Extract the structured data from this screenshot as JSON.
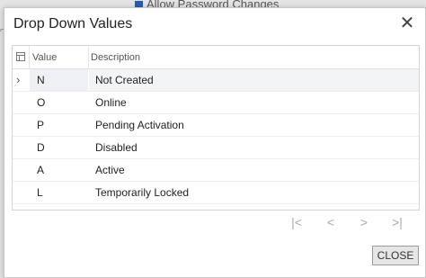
{
  "background": {
    "partial_label": "Allow Password Changes"
  },
  "dialog": {
    "title": "Drop Down Values",
    "close_icon": "close-icon",
    "close_button_label": "CLOSE"
  },
  "grid": {
    "columns": [
      {
        "key": "value",
        "label": "Value"
      },
      {
        "key": "description",
        "label": "Description"
      }
    ],
    "selected_row_index": 0,
    "rows": [
      {
        "value": "N",
        "description": "Not Created"
      },
      {
        "value": "O",
        "description": "Online"
      },
      {
        "value": "P",
        "description": "Pending Activation"
      },
      {
        "value": "D",
        "description": "Disabled"
      },
      {
        "value": "A",
        "description": "Active"
      },
      {
        "value": "L",
        "description": "Temporarily Locked"
      }
    ]
  },
  "pager": {
    "first": "|<",
    "prev": "<",
    "next": ">",
    "last": ">|"
  },
  "colors": {
    "selected_row_bg": "#eef0f4",
    "pager_disabled": "#aaaaaa",
    "button_bg": "#e6e6e6"
  }
}
